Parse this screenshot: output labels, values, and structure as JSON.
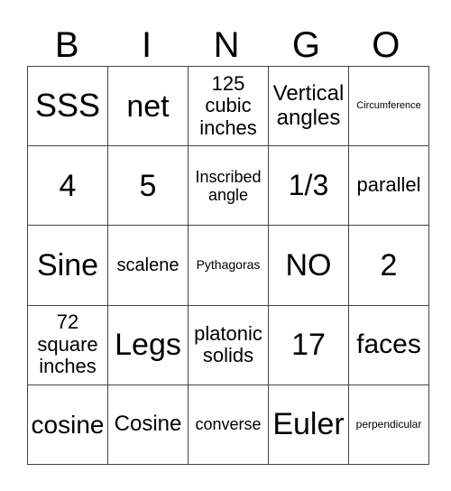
{
  "header": [
    "B",
    "I",
    "N",
    "G",
    "O"
  ],
  "rows": [
    [
      {
        "t": "SSS",
        "s": 36
      },
      {
        "t": "net",
        "s": 34
      },
      {
        "t": "125 cubic inches",
        "s": 22
      },
      {
        "t": "Vertical angles",
        "s": 24
      },
      {
        "t": "Circumference",
        "s": 11
      }
    ],
    [
      {
        "t": "4",
        "s": 34
      },
      {
        "t": "5",
        "s": 34
      },
      {
        "t": "Inscribed angle",
        "s": 18
      },
      {
        "t": "1/3",
        "s": 32
      },
      {
        "t": "parallel",
        "s": 22
      }
    ],
    [
      {
        "t": "Sine",
        "s": 34
      },
      {
        "t": "scalene",
        "s": 20
      },
      {
        "t": "Pythagoras",
        "s": 14
      },
      {
        "t": "NO",
        "s": 34
      },
      {
        "t": "2",
        "s": 34
      }
    ],
    [
      {
        "t": "72 square inches",
        "s": 22
      },
      {
        "t": "Legs",
        "s": 34
      },
      {
        "t": "platonic solids",
        "s": 22
      },
      {
        "t": "17",
        "s": 34
      },
      {
        "t": "faces",
        "s": 30
      }
    ],
    [
      {
        "t": "cosine",
        "s": 28
      },
      {
        "t": "Cosine",
        "s": 24
      },
      {
        "t": "converse",
        "s": 18
      },
      {
        "t": "Euler",
        "s": 34
      },
      {
        "t": "perpendicular",
        "s": 12
      }
    ]
  ]
}
